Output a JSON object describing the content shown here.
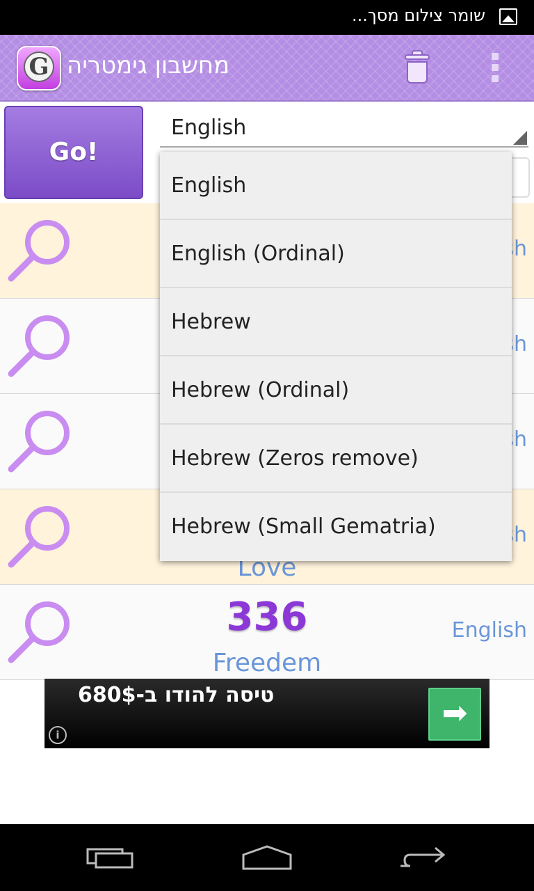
{
  "status_bar": {
    "notification_text": "שומר צילום מסך...",
    "icon": "image-icon"
  },
  "action_bar": {
    "logo_letter": "G",
    "title": "מחשבון גימטריה",
    "trash_icon": "trash-icon",
    "overflow_icon": "overflow-menu-icon"
  },
  "toolbar": {
    "go_label": "Go!",
    "selected_language": "English",
    "input_value": ""
  },
  "dropdown": {
    "options": [
      "English",
      "English (Ordinal)",
      "Hebrew",
      "Hebrew (Ordinal)",
      "Hebrew (Zeros remove)",
      "Hebrew (Small Gematria)"
    ]
  },
  "results": [
    {
      "value": "",
      "word": "",
      "language": "English",
      "highlight": true
    },
    {
      "value": "",
      "word": "",
      "language": "English",
      "highlight": false
    },
    {
      "value": "",
      "word": "",
      "language": "English",
      "highlight": false
    },
    {
      "value": "",
      "word": "Love",
      "language": "English",
      "highlight": true
    },
    {
      "value": "336",
      "word": "Freedem",
      "language": "English",
      "highlight": false
    }
  ],
  "ad": {
    "text": "טיסה להודו ב-680$",
    "info_icon": "i",
    "arrow": "➡"
  },
  "colors": {
    "action_bar": "#b48de4",
    "go_button": "#8a5bd4",
    "value_text": "#8c38d6",
    "link_text": "#6a96d8",
    "highlight_row": "#fff3dc"
  }
}
